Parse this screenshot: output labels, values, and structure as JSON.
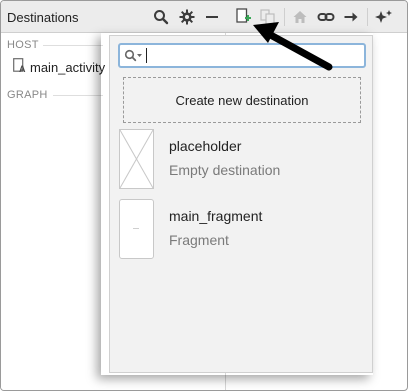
{
  "left_panel": {
    "title": "Destinations",
    "sections": {
      "host": "HOST",
      "graph": "GRAPH"
    },
    "host_item": {
      "label": "main_activity",
      "icon": "activity-icon"
    },
    "header_icons": [
      "search-icon",
      "gear-icon",
      "minus-icon"
    ]
  },
  "toolbar": {
    "icons": [
      "new-destination-icon",
      "copy-icon",
      "home-icon",
      "link-icon",
      "arrow-right-icon",
      "auto-arrange-icon"
    ],
    "accent_color": "#3aa757"
  },
  "popup": {
    "search": {
      "value": "",
      "placeholder": ""
    },
    "create_label": "Create new destination",
    "destinations": [
      {
        "name": "placeholder",
        "subtitle": "Empty destination"
      },
      {
        "name": "main_fragment",
        "subtitle": "Fragment"
      }
    ]
  },
  "annotation": {
    "arrow_color": "#000000"
  }
}
